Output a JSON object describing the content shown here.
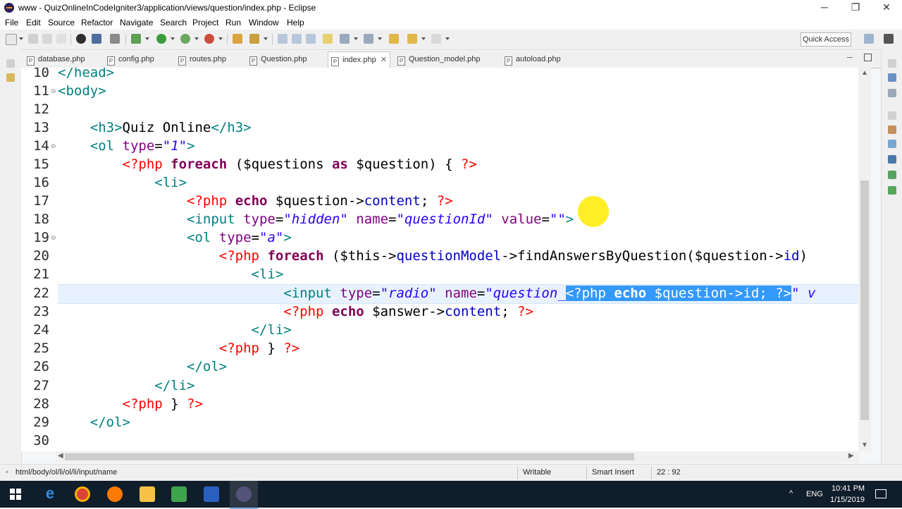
{
  "window": {
    "title": "www - QuizOnlineInCodeIgniter3/application/views/question/index.php - Eclipse",
    "minimize": "─",
    "maximize": "❐",
    "close": "✕"
  },
  "menu": [
    "File",
    "Edit",
    "Source",
    "Refactor",
    "Navigate",
    "Search",
    "Project",
    "Run",
    "Window",
    "Help"
  ],
  "quick_access": "Quick Access",
  "tabs": [
    {
      "label": "database.php"
    },
    {
      "label": "config.php"
    },
    {
      "label": "routes.php"
    },
    {
      "label": "Question.php"
    },
    {
      "label": "index.php",
      "active": true,
      "close": "✕"
    },
    {
      "label": "Question_model.php"
    },
    {
      "label": "autoload.php"
    }
  ],
  "editor": {
    "line_numbers": [
      "10",
      "11",
      "12",
      "13",
      "14",
      "15",
      "16",
      "17",
      "18",
      "19",
      "20",
      "21",
      "22",
      "23",
      "24",
      "25",
      "26",
      "27",
      "28",
      "29",
      "30"
    ],
    "lines": {
      "l10_a": "</head>",
      "l11_a": "<body>",
      "l13_a": "<h3>",
      "l13_b": "Quiz Online",
      "l13_c": "</h3>",
      "l14_a": "<ol ",
      "l14_b": "type",
      "l14_c": "=",
      "l14_d": "\"1\"",
      "l14_e": ">",
      "l15_a": "<?php",
      "l15_b": "foreach",
      "l15_c": " ($questions ",
      "l15_d": "as",
      "l15_e": " $question) { ",
      "l15_f": "?>",
      "l16_a": "<li>",
      "l17_a": "<?php",
      "l17_b": "echo",
      "l17_c": " $question->",
      "l17_d": "content",
      "l17_e": "; ",
      "l17_f": "?>",
      "l18_a": "<input ",
      "l18_b": "type",
      "l18_c": "=",
      "l18_d": "\"hidden\"",
      "l18_e": "name",
      "l18_f": "=",
      "l18_g": "\"questionId\"",
      "l18_h": "value",
      "l18_i": "=",
      "l18_j": "\"\"",
      "l18_k": ">",
      "l19_a": "<ol ",
      "l19_b": "type",
      "l19_c": "=",
      "l19_d": "\"a\"",
      "l19_e": ">",
      "l20_a": "<?php",
      "l20_b": "foreach",
      "l20_c": " ($this->",
      "l20_d": "questionModel",
      "l20_e": "->findAnswersByQuestion($question->",
      "l20_f": "id",
      "l20_g": ")",
      "l21_a": "<li>",
      "l22_a": "<input ",
      "l22_b": "type",
      "l22_c": "=",
      "l22_d": "\"radio\"",
      "l22_e": "name",
      "l22_f": "=",
      "l22_g": "\"question_",
      "l22_h": "<?php",
      "l22_i": "echo",
      "l22_j": " $question->",
      "l22_k": "id",
      "l22_l": "; ",
      "l22_m": "?>",
      "l22_n": "\" v",
      "l23_a": "<?php",
      "l23_b": "echo",
      "l23_c": " $answer->",
      "l23_d": "content",
      "l23_e": "; ",
      "l23_f": "?>",
      "l24_a": "</li>",
      "l25_a": "<?php",
      "l25_b": " } ",
      "l25_c": "?>",
      "l26_a": "</ol>",
      "l27_a": "</li>",
      "l28_a": "<?php",
      "l28_b": " } ",
      "l28_c": "?>",
      "l29_a": "</ol>"
    }
  },
  "status": {
    "path": "html/body/ol/li/ol/li/input/name",
    "writable": "Writable",
    "insert_mode": "Smart Insert",
    "position": "22 : 92"
  },
  "taskbar": {
    "lang": "ENG",
    "time": "10:41 PM",
    "date": "1/15/2019",
    "tray_arrow": "^"
  },
  "colors": {
    "tag": "#008080",
    "attr": "#7f007f",
    "string": "#2a00ff",
    "php_delim": "#ff0000",
    "keyword": "#7f0055",
    "selection": "#3399ff",
    "taskbar": "#101d2b"
  }
}
